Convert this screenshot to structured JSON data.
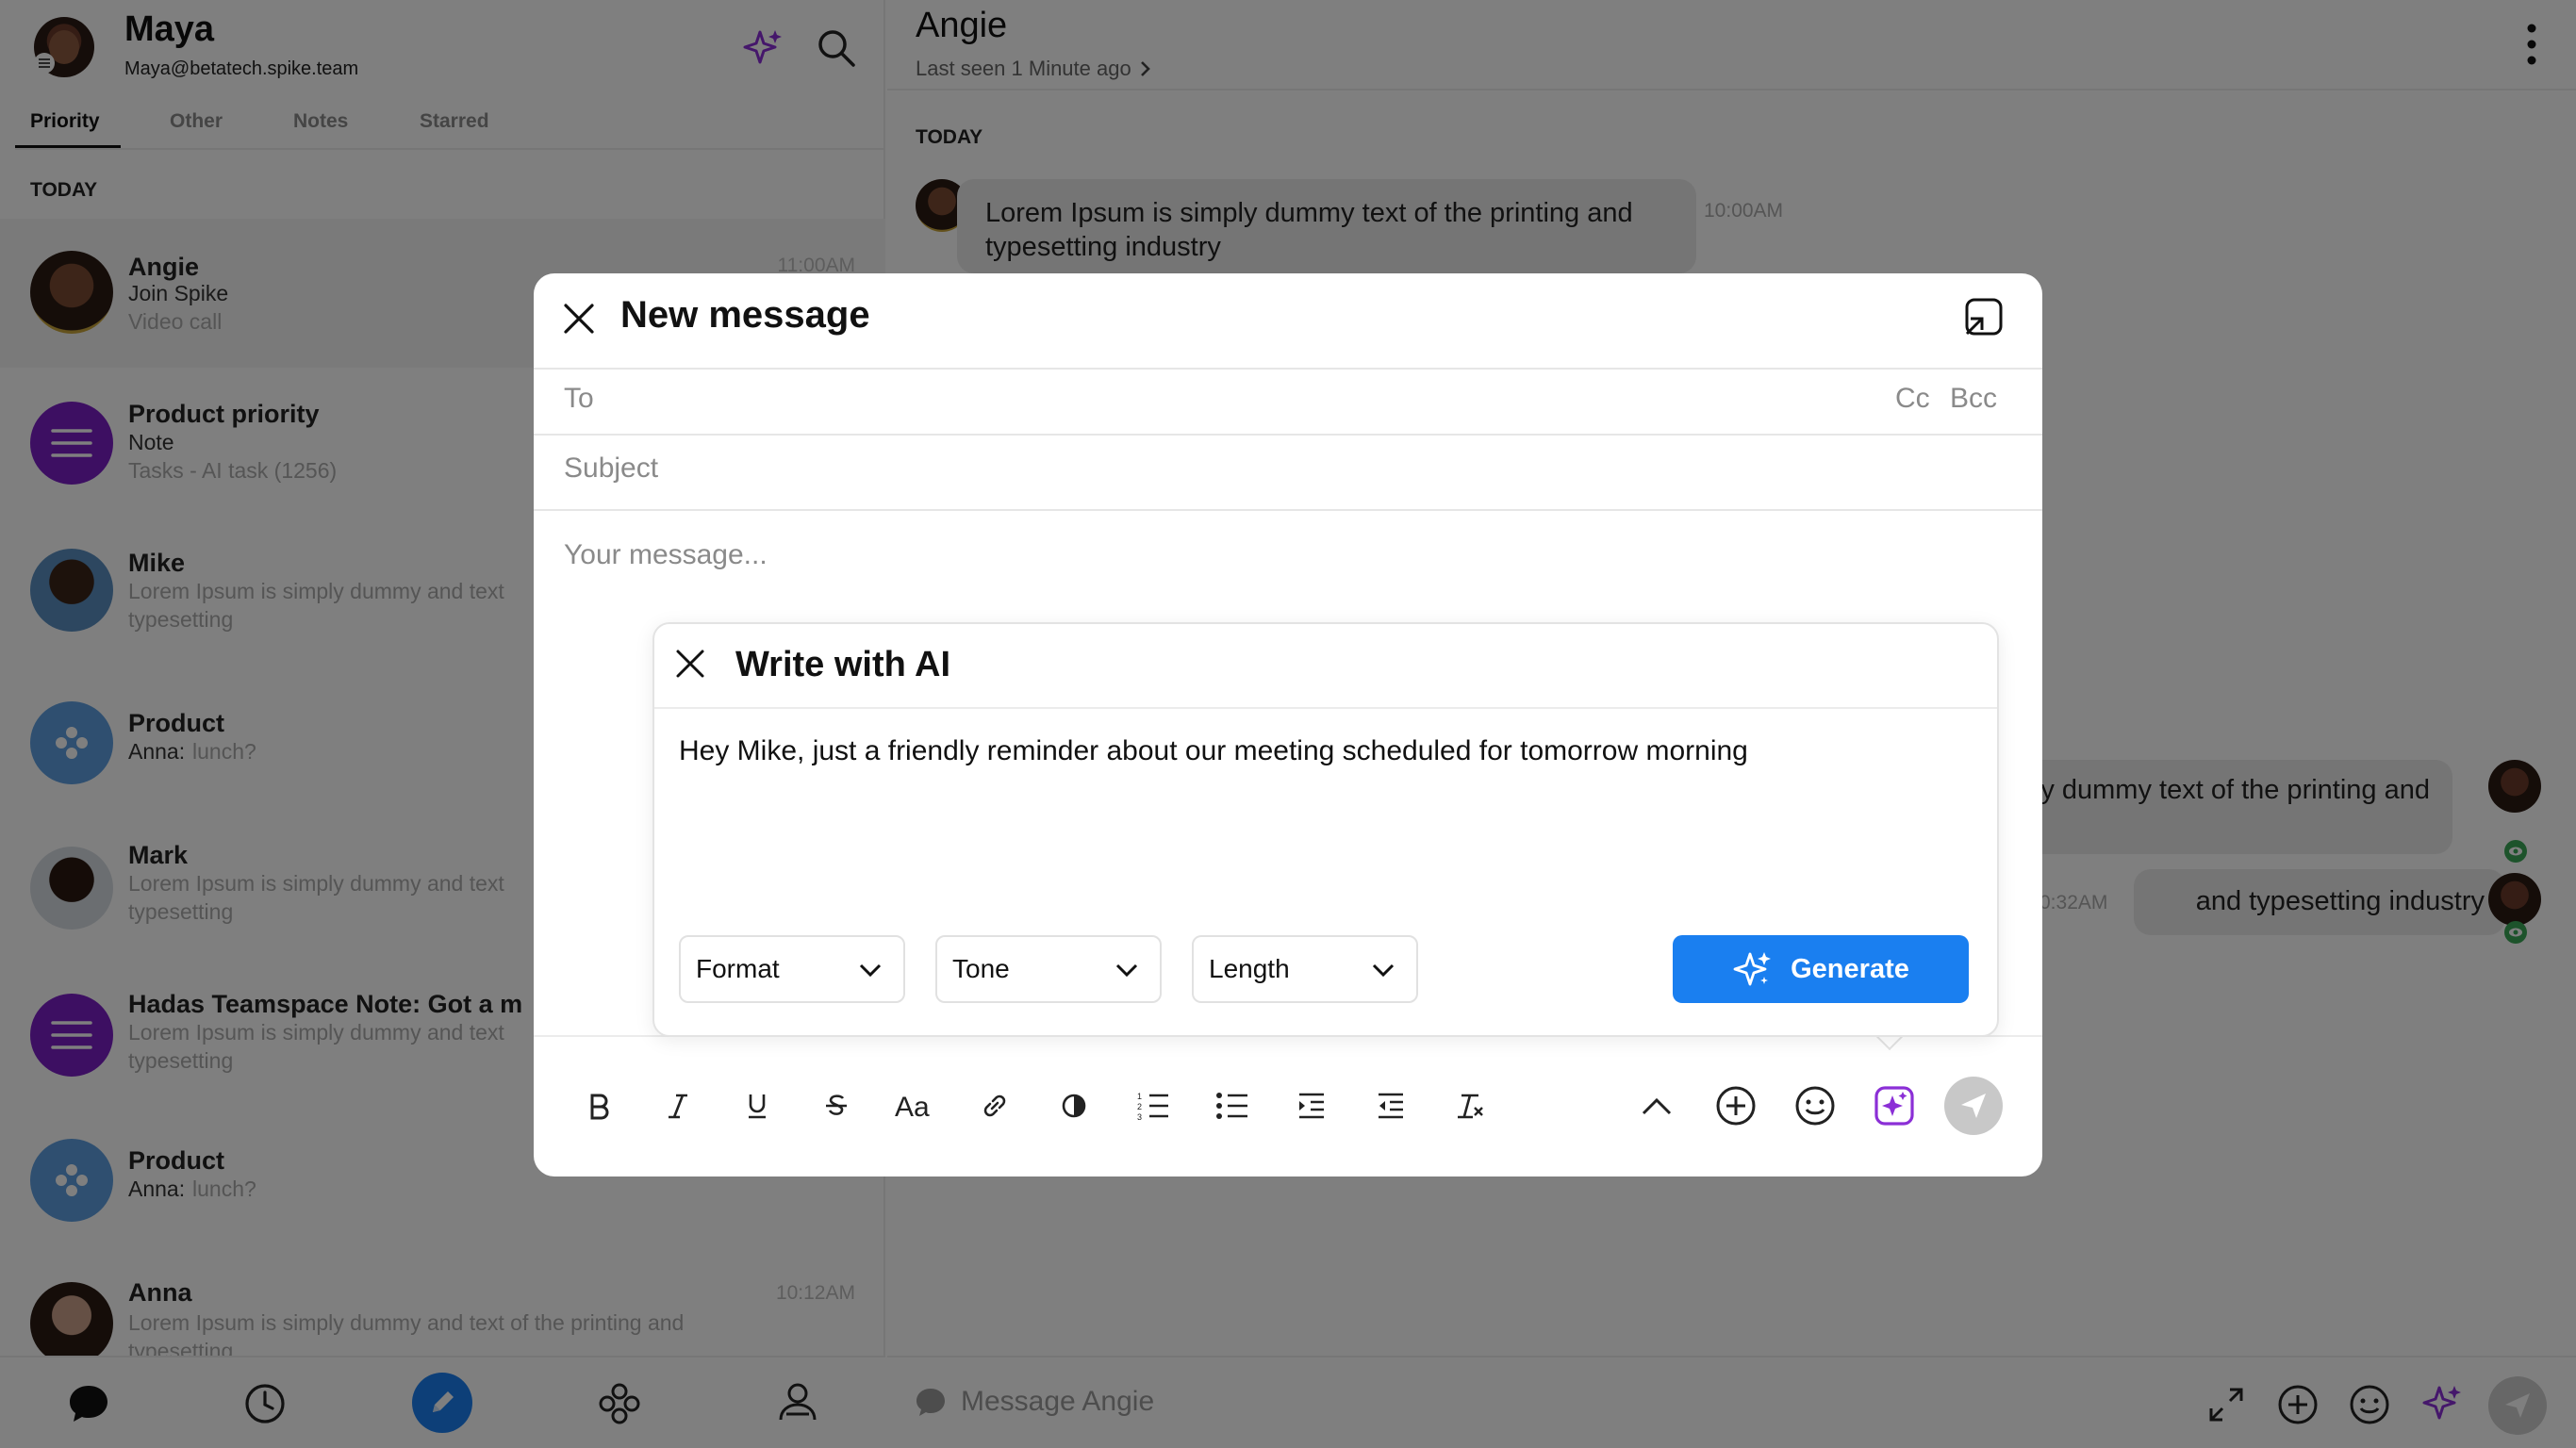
{
  "user": {
    "name": "Maya",
    "email": "Maya@betatech.spike.team"
  },
  "tabs": [
    "Priority",
    "Other",
    "Notes",
    "Starred"
  ],
  "section_today": "TODAY",
  "conversations": [
    {
      "name": "Angie",
      "line1": "Join Spike",
      "line2": "Video call",
      "time": "11:00AM"
    },
    {
      "name": "Product priority",
      "line1": "Note",
      "line2": "Tasks - AI task (1256)"
    },
    {
      "name": "Mike",
      "line2": "Lorem Ipsum is simply dummy and text",
      "line3": "typesetting"
    },
    {
      "name": "Product",
      "sender": "Anna:",
      "line2": "lunch?"
    },
    {
      "name": "Mark",
      "line2": "Lorem Ipsum is simply dummy and text",
      "line3": "typesetting"
    },
    {
      "name": "Hadas Teamspace Note: Got a m",
      "line2": "Lorem Ipsum is simply dummy and text",
      "line3": "typesetting"
    },
    {
      "name": "Product",
      "sender": "Anna:",
      "line2": "lunch?"
    },
    {
      "name": "Anna",
      "line2": "Lorem Ipsum is simply dummy and text of the printing and",
      "line3": "typesetting",
      "time": "10:12AM"
    }
  ],
  "chat": {
    "contact": "Angie",
    "status": "Last seen 1 Minute ago",
    "day": "TODAY",
    "msg1": "Lorem Ipsum is simply dummy text of the printing and typesetting industry",
    "msg1_time": "10:00AM",
    "msg2_partial": "ply dummy text of the printing and",
    "msg3": "and typesetting industry",
    "msg3_time": "0:32AM",
    "composer_placeholder": "Message Angie"
  },
  "modal": {
    "title": "New message",
    "to_label": "To",
    "cc": "Cc",
    "bcc": "Bcc",
    "subject_placeholder": "Subject",
    "body_placeholder": "Your message..."
  },
  "ai": {
    "title": "Write with AI",
    "prompt": "Hey Mike, just a friendly reminder about our meeting scheduled for tomorrow morning",
    "format": "Format",
    "tone": "Tone",
    "length": "Length",
    "generate": "Generate"
  },
  "colors": {
    "accent_blue": "#1a7ff0",
    "purple": "#8b2fd6",
    "overlay": "rgba(0,0,0,0.5)"
  }
}
